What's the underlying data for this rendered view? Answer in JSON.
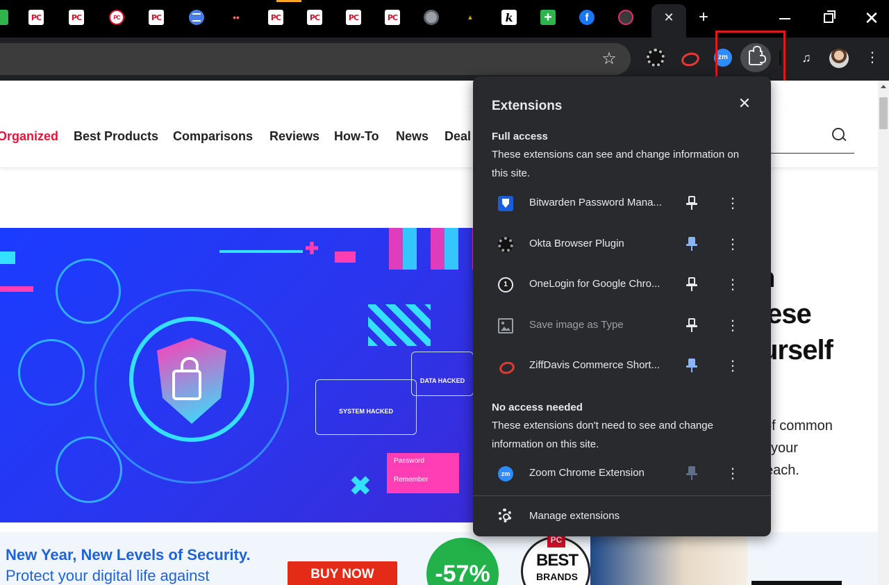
{
  "browser": {
    "tabs": [
      {
        "favicon": "green-square-icon"
      },
      {
        "favicon": "pc-logo-icon",
        "text": "PC"
      },
      {
        "favicon": "pc-logo-icon",
        "text": "PC"
      },
      {
        "favicon": "pc-round-logo-icon",
        "text": "PC"
      },
      {
        "favicon": "pc-logo-icon",
        "text": "PC"
      },
      {
        "favicon": "list-circle-icon"
      },
      {
        "favicon": "three-dots-icon"
      },
      {
        "favicon": "pc-logo-icon",
        "text": "PC"
      },
      {
        "favicon": "pc-logo-icon",
        "text": "PC"
      },
      {
        "favicon": "pc-logo-icon",
        "text": "PC"
      },
      {
        "favicon": "pc-logo-icon",
        "text": "PC"
      },
      {
        "favicon": "globe-icon"
      },
      {
        "favicon": "triangle-icon"
      },
      {
        "favicon": "k-letter-icon"
      },
      {
        "favicon": "green-plus-icon"
      },
      {
        "favicon": "facebook-icon",
        "text": "f"
      },
      {
        "favicon": "instagram-icon"
      }
    ],
    "toolbar": {
      "zoom_ext_label": "zm",
      "icons": [
        "star-icon",
        "okta-icon",
        "ziffdavis-icon",
        "zoom-icon",
        "puzzle-icon",
        "media-queue-icon",
        "profile-avatar",
        "more-vert-icon"
      ]
    }
  },
  "page": {
    "nav": {
      "items": [
        "Organized",
        "Best Products",
        "Comparisons",
        "Reviews",
        "How-To",
        "News",
        "Deal"
      ]
    },
    "headline_fragments": [
      "n",
      "ese",
      "urself"
    ],
    "body_fragments": [
      "of common",
      "your",
      "each."
    ],
    "hero": {
      "card_system": "SYSTEM HACKED",
      "card_data": "DATA HACKED",
      "password_label": "Password",
      "remember_label": "Remember"
    },
    "banner": {
      "line1": "New Year, New Levels of Security.",
      "line2": "Protect your digital life against",
      "cta": "BUY NOW",
      "discount": "-57%",
      "badge_pc": "PC",
      "badge_best": "BEST",
      "badge_brands": "BRANDS"
    }
  },
  "extensions_popup": {
    "title": "Extensions",
    "full_access": {
      "title": "Full access",
      "description": "These extensions can see and change information on this site.",
      "items": [
        {
          "name": "Bitwarden Password Mana...",
          "icon": "bitwarden-icon",
          "pinned": false
        },
        {
          "name": "Okta Browser Plugin",
          "icon": "okta-icon",
          "pinned": true
        },
        {
          "name": "OneLogin for Google Chro...",
          "icon": "onelogin-icon",
          "pinned": false
        },
        {
          "name": "Save image as Type",
          "icon": "image-icon",
          "pinned": false,
          "dimmed": true
        },
        {
          "name": "ZiffDavis Commerce Short...",
          "icon": "ziffdavis-icon",
          "pinned": true
        }
      ]
    },
    "no_access": {
      "title": "No access needed",
      "description": "These extensions don't need to see and change information on this site.",
      "items": [
        {
          "name": "Zoom Chrome Extension",
          "icon": "zoom-icon",
          "pinned": true,
          "pin_disabled": true
        }
      ]
    },
    "onelogin_badge": "1",
    "zoom_badge": "zm",
    "manage_label": "Manage extensions"
  },
  "colors": {
    "accent_blue": "#8ab4f8",
    "popup_bg": "#292a2d",
    "nav_hot": "#e4143c",
    "highlight_red": "#e01818"
  }
}
